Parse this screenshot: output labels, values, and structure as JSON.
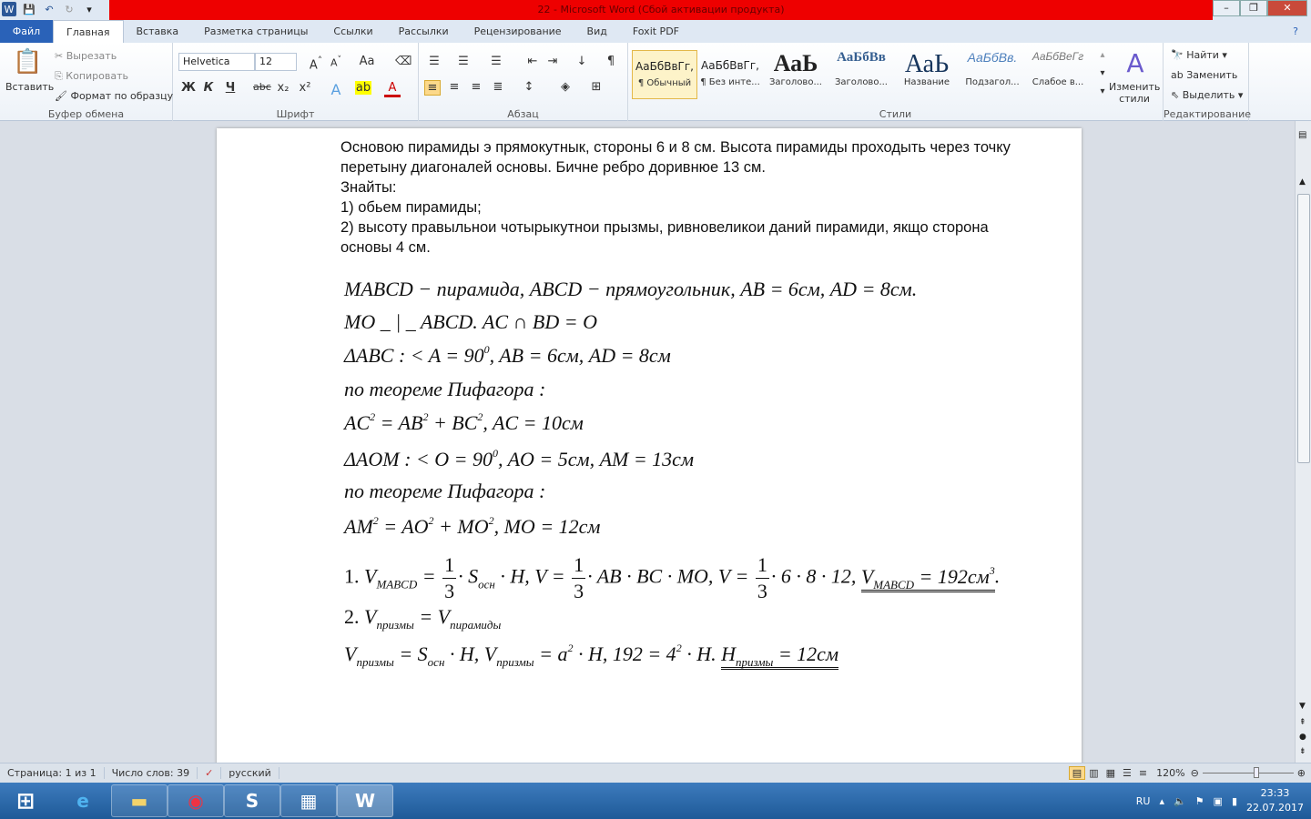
{
  "window": {
    "title": "22  -  Microsoft Word (Сбой активации продукта)",
    "controls": [
      "–",
      "❐",
      "✕"
    ]
  },
  "tabs": [
    "Файл",
    "Главная",
    "Вставка",
    "Разметка страницы",
    "Ссылки",
    "Рассылки",
    "Рецензирование",
    "Вид",
    "Foxit PDF"
  ],
  "clipboard": {
    "paste": "Вставить",
    "cut": "Вырезать",
    "copy": "Копировать",
    "format_painter": "Формат по образцу",
    "label": "Буфер обмена"
  },
  "font": {
    "name": "Helvetica",
    "size": "12",
    "label": "Шрифт",
    "bold": "Ж",
    "italic": "К",
    "underline": "Ч",
    "strike": "abc"
  },
  "paragraph": {
    "label": "Абзац"
  },
  "styles": {
    "items": [
      {
        "preview": "АаБбВвГг,",
        "name": "¶ Обычный"
      },
      {
        "preview": "АаБбВвГг,",
        "name": "¶ Без инте..."
      },
      {
        "preview": "АаЬ",
        "name": "Заголово..."
      },
      {
        "preview": "АаБбВв",
        "name": "Заголово..."
      },
      {
        "preview": "АаЬ",
        "name": "Название"
      },
      {
        "preview": "АаБбВв.",
        "name": "Подзагол..."
      },
      {
        "preview": "АаБбВеГг",
        "name": "Слабое в..."
      }
    ],
    "change": "Изменить стили",
    "label": "Стили"
  },
  "editing": {
    "find": "Найти",
    "replace": "Заменить",
    "select": "Выделить",
    "label": "Редактирование"
  },
  "document": {
    "paragraphs": [
      "Основою пирамиды э прямокутнык, стороны 6 и 8 см. Высота пирамиды проходыть через точку перетыну диагоналей основы. Бичне ребро доривнюе 13 см.",
      "Знайты:",
      "1) обьем пирамиды;",
      "2) высоту правыльнои чотырыкутнои прызмы, ривновеликои даний пирамиди, якщо сторона основы 4 см."
    ],
    "math": [
      [
        [
          "n",
          "MABCD − пирамида, ABCD − прямоугольник, AB = 6см, AD = 8см."
        ]
      ],
      [
        [
          "n",
          "MO _ | _ ABCD.    AC ∩ BD = O"
        ]
      ],
      [
        [
          "n",
          "ΔABC : < A = 90"
        ],
        [
          "sup",
          "0"
        ],
        [
          "n",
          ", AB = 6см, AD = 8см"
        ]
      ],
      [
        [
          "n",
          "по теореме Пифагора :"
        ]
      ],
      [
        [
          "n",
          "AC"
        ],
        [
          "sup",
          "2"
        ],
        [
          "n",
          " = AB"
        ],
        [
          "sup",
          "2"
        ],
        [
          "n",
          " + BC"
        ],
        [
          "sup",
          "2"
        ],
        [
          "n",
          ",    AC = 10см"
        ]
      ],
      [
        [
          "n",
          "ΔAOM : < O = 90"
        ],
        [
          "sup",
          "0"
        ],
        [
          "n",
          ", AO = 5см, AM  = 13см"
        ]
      ],
      [
        [
          "n",
          "по теореме Пифагора :"
        ]
      ],
      [
        [
          "n",
          "AM"
        ],
        [
          "sup",
          "2"
        ],
        [
          "n",
          " = AO"
        ],
        [
          "sup",
          "2"
        ],
        [
          "n",
          " + MO"
        ],
        [
          "sup",
          "2"
        ],
        [
          "n",
          ",    MO = 12см"
        ]
      ],
      [
        [
          "u",
          "1.    "
        ],
        [
          "n",
          "V"
        ],
        [
          "sub",
          "MABCD"
        ],
        [
          "n",
          " = "
        ],
        [
          "frac",
          "1",
          "3"
        ],
        [
          "n",
          "· S"
        ],
        [
          "sub",
          "осн"
        ],
        [
          "n",
          " · H, V = "
        ],
        [
          "frac",
          "1",
          "3"
        ],
        [
          "n",
          "· AB · BC · MO, V = "
        ],
        [
          "frac",
          "1",
          "3"
        ],
        [
          "n",
          "· 6 · 8 · 12,    "
        ],
        [
          "dbl",
          "V|MABCD| = 192см|3"
        ],
        [
          "n",
          "."
        ]
      ],
      [
        [
          "u",
          "2.    "
        ],
        [
          "n",
          "V"
        ],
        [
          "sub",
          "призмы"
        ],
        [
          "n",
          " = V"
        ],
        [
          "sub",
          "пирамиды"
        ]
      ],
      [
        [
          "n",
          "V"
        ],
        [
          "sub",
          "призмы"
        ],
        [
          "n",
          " = S"
        ],
        [
          "sub",
          "осн"
        ],
        [
          "n",
          " · H,    V"
        ],
        [
          "sub",
          "призмы"
        ],
        [
          "n",
          " = a"
        ],
        [
          "sup",
          "2"
        ],
        [
          "n",
          " · H,    192 = 4"
        ],
        [
          "sup",
          "2"
        ],
        [
          "n",
          " · H.    "
        ],
        [
          "dbl2",
          "H|призмы| = 12см"
        ]
      ]
    ]
  },
  "status": {
    "page": "Страница: 1 из 1",
    "words": "Число слов: 39",
    "lang": "русский",
    "zoom": "120%"
  },
  "taskbar": {
    "lang": "RU",
    "time": "23:33",
    "date": "22.07.2017"
  }
}
